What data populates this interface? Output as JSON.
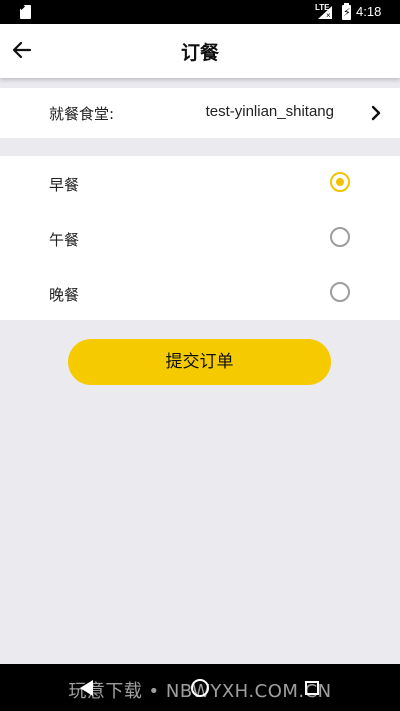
{
  "status_bar": {
    "network": "LTE",
    "time": "4:18",
    "icons": [
      "sim-card-icon",
      "signal-icon",
      "battery-charging-icon"
    ]
  },
  "header": {
    "title": "订餐",
    "back_icon": "arrow-left-icon"
  },
  "canteen": {
    "label": "就餐食堂:",
    "value": "test-yinlian_shitang",
    "icon": "chevron-right-icon"
  },
  "meals": [
    {
      "label": "早餐",
      "selected": true
    },
    {
      "label": "午餐",
      "selected": false
    },
    {
      "label": "晚餐",
      "selected": false
    }
  ],
  "submit": {
    "label": "提交订单"
  },
  "colors": {
    "accent": "#f5cb00",
    "background": "#ebeaef"
  },
  "nav_bar": {
    "icons": [
      "back-triangle-icon",
      "home-circle-icon",
      "recents-square-icon"
    ]
  },
  "watermark": "玩意下载 • NBWYXH.COM.CN"
}
